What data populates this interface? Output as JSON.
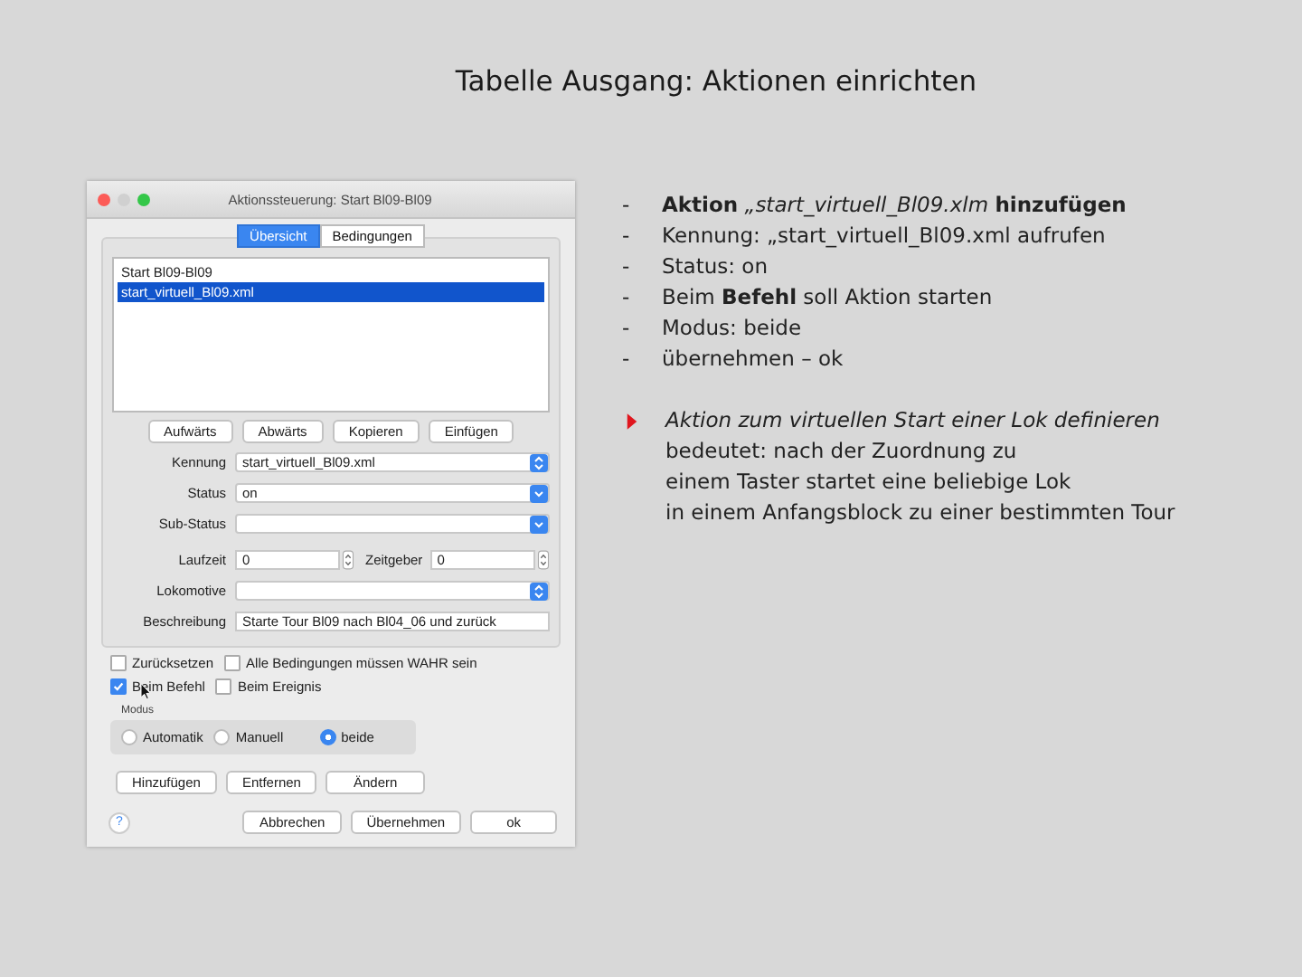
{
  "slide_title": "Tabelle Ausgang:  Aktionen einrichten",
  "dialog": {
    "title": "Aktionssteuerung: Start Bl09-Bl09",
    "tabs": [
      {
        "label": "Übersicht",
        "selected": true
      },
      {
        "label": "Bedingungen",
        "selected": false
      }
    ],
    "list": [
      {
        "label": "Start Bl09-Bl09",
        "selected": false
      },
      {
        "label": "start_virtuell_Bl09.xml",
        "selected": true
      }
    ],
    "list_buttons": [
      "Aufwärts",
      "Abwärts",
      "Kopieren",
      "Einfügen"
    ],
    "fields": [
      {
        "kind": "select",
        "label": "Kennung",
        "value": "start_virtuell_Bl09.xml",
        "accent": true
      },
      {
        "kind": "select",
        "label": "Status",
        "value": "on",
        "accent": false
      },
      {
        "kind": "select",
        "label": "Sub-Status",
        "accent": false
      },
      {
        "kind": "steppers",
        "label": "Laufzeit",
        "value": "0",
        "label2": "Zeitgeber",
        "value2": "0"
      },
      {
        "kind": "select",
        "label": "Lokomotive",
        "accent": true
      },
      {
        "kind": "text",
        "label": "Beschreibung",
        "value": "Starte Tour Bl09 nach Bl04_06 und zurück"
      }
    ],
    "checkboxes": [
      {
        "label": "Zurücksetzen",
        "checked": false
      },
      {
        "label": "Alle Bedingungen müssen WAHR sein",
        "checked": false
      },
      {
        "label": "Beim Befehl",
        "checked": true
      },
      {
        "label": "Beim Ereignis",
        "checked": false
      }
    ],
    "mode": {
      "legend": "Modus",
      "options": [
        {
          "label": "Automatik",
          "selected": false
        },
        {
          "label": "Manuell",
          "selected": false
        },
        {
          "label": "beide",
          "selected": true
        }
      ]
    },
    "action_buttons": [
      "Hinzufügen",
      "Entfernen",
      "Ändern"
    ],
    "help": "?",
    "footer_buttons": [
      "Abbrechen",
      "Übernehmen",
      "ok"
    ]
  },
  "bullets": [
    "**Aktion** *„start_virtuell_Bl09.xlm* **hinzufügen**",
    "Kennung: „start_virtuell_Bl09.xml aufrufen",
    "Status: on",
    "Beim **Befehl** soll Aktion starten",
    "Modus: beide",
    "übernehmen – ok"
  ],
  "bullet_mark": "-",
  "note": {
    "heading": "Aktion zum virtuellen Start einer Lok definieren",
    "lines": [
      "bedeutet: nach der Zuordnung zu",
      "einem Taster startet eine beliebige Lok",
      "in einem Anfangsblock zu einer bestimmten Tour"
    ]
  }
}
